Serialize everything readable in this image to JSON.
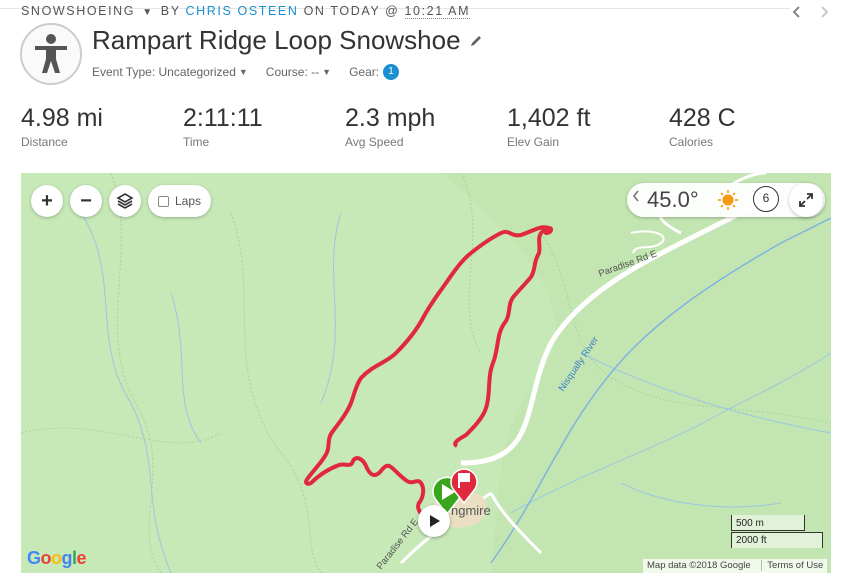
{
  "header": {
    "activity_type": "SNOWSHOEING",
    "by_text": "BY",
    "author": "CHRIS OSTEEN",
    "on_text": "ON TODAY @",
    "time": "10:21 AM"
  },
  "nav": {
    "prev_icon": "chevron-left-icon",
    "next_icon": "chevron-right-icon"
  },
  "activity": {
    "title": "Rampart Ridge Loop Snowshoe",
    "event_type_label": "Event Type: Uncategorized",
    "course_label": "Course: --",
    "gear_label": "Gear:",
    "gear_count": "1"
  },
  "stats": [
    {
      "value": "4.98 mi",
      "label": "Distance"
    },
    {
      "value": "2:11:11",
      "label": "Time"
    },
    {
      "value": "2.3 mph",
      "label": "Avg Speed"
    },
    {
      "value": "1,402 ft",
      "label": "Elev Gain"
    },
    {
      "value": "428 C",
      "label": "Calories"
    }
  ],
  "map": {
    "zoom_in": "+",
    "zoom_out": "−",
    "laps_label": "Laps",
    "sun_angle": "45.0°",
    "clock_hour": "6",
    "poi_label": "ngmire",
    "road_label_1": "Paradise Rd E",
    "road_label_2": "Paradise Rd E",
    "river_label": "Nisqually River",
    "google": "Google",
    "attribution": "Map data ©2018 Google",
    "terms": "Terms of Use",
    "scale_metric": "500 m",
    "scale_imperial": "2000 ft",
    "colors": {
      "route": "#e0283e",
      "terrain": "#c7e8b7",
      "start": "#3aa61e",
      "accent": "#1a8fd1"
    }
  }
}
